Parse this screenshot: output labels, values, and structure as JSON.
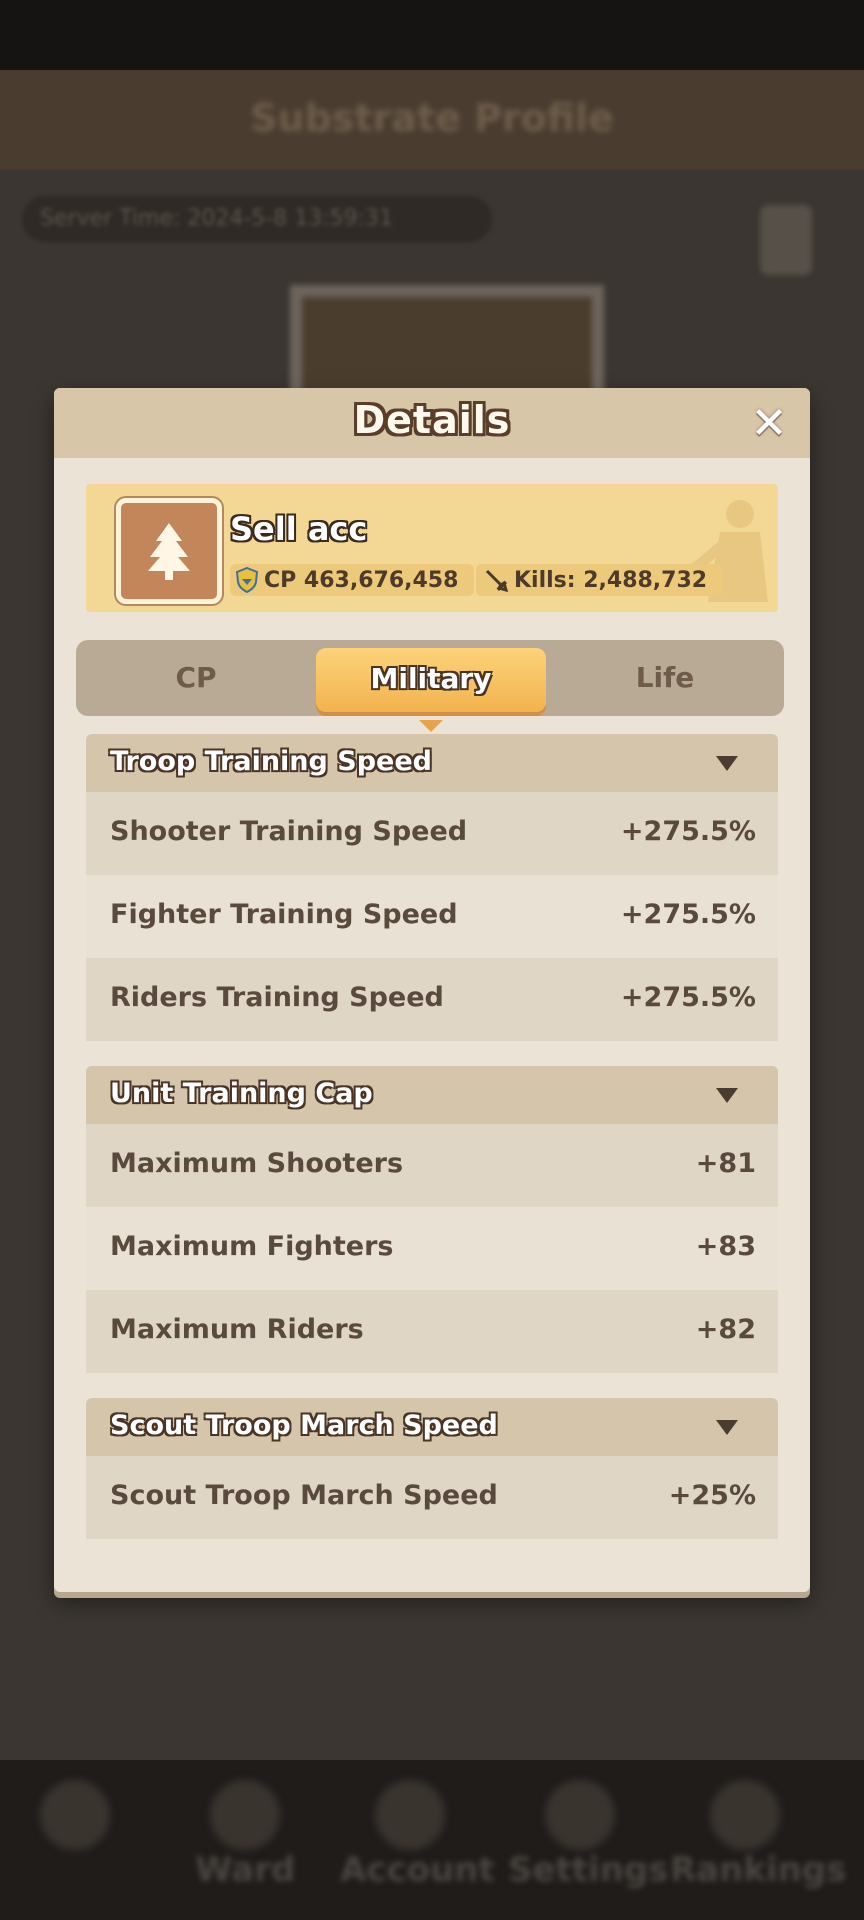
{
  "background": {
    "title": "Substrate Profile",
    "server_time": "Server Time: 2024-5-8 13:59:31",
    "nav": [
      "Ward",
      "Account",
      "Settings",
      "Rankings"
    ]
  },
  "dialog": {
    "title": "Details",
    "close_icon": "close-icon"
  },
  "profile": {
    "avatar_icon": "tree-icon",
    "name": "Sell acc",
    "cp_label": "CP 463,676,458",
    "kills_label": "Kills:  2,488,732"
  },
  "tabs": {
    "cp": "CP",
    "military": "Military",
    "life": "Life",
    "selected": "Military"
  },
  "sections": [
    {
      "title": "Troop Training Speed",
      "rows": [
        {
          "label": "Shooter Training Speed",
          "value": "+275.5%"
        },
        {
          "label": "Fighter Training Speed",
          "value": "+275.5%"
        },
        {
          "label": "Riders Training Speed",
          "value": "+275.5%"
        }
      ]
    },
    {
      "title": "Unit Training Cap",
      "rows": [
        {
          "label": "Maximum Shooters",
          "value": "+81"
        },
        {
          "label": "Maximum Fighters",
          "value": "+83"
        },
        {
          "label": "Maximum Riders",
          "value": "+82"
        }
      ]
    },
    {
      "title": "Scout Troop March Speed",
      "rows": [
        {
          "label": "Scout Troop March Speed",
          "value": "+25%"
        }
      ]
    }
  ],
  "colors": {
    "panel": "#ebe3d6",
    "banner": "#f3d795",
    "tab_active": "#f2b34e",
    "text": "#5a4a3e"
  }
}
